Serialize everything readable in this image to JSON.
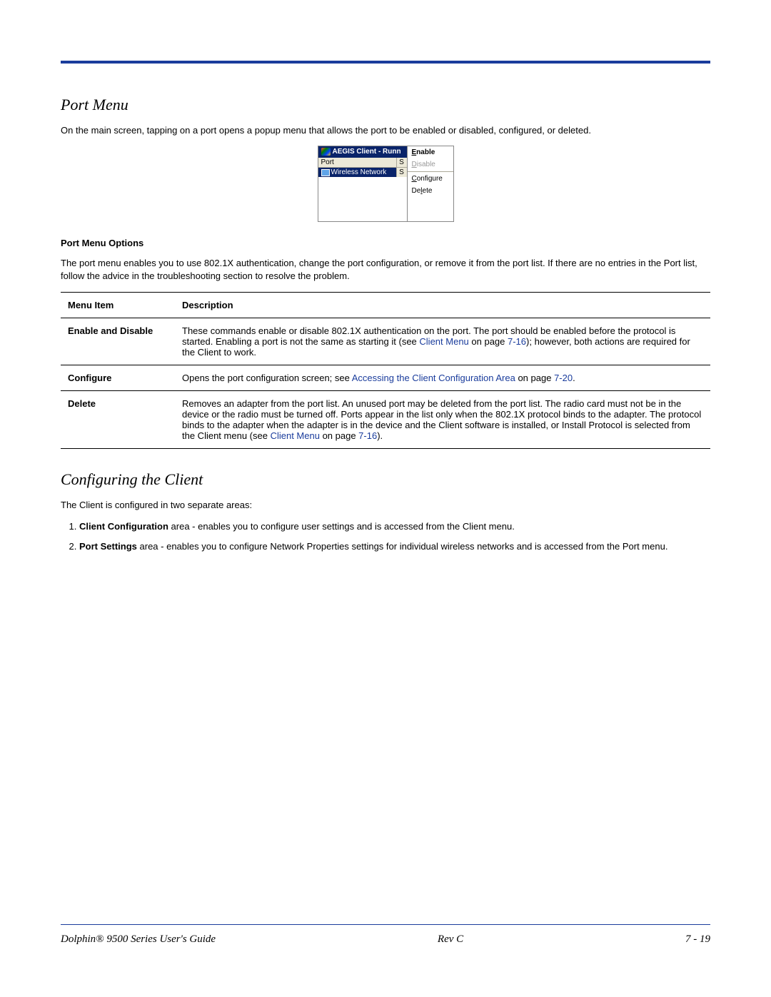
{
  "section1": {
    "heading": "Port Menu",
    "intro": "On the main screen, tapping on a port opens a popup menu that allows the port to be enabled or disabled, configured, or deleted."
  },
  "screenshot": {
    "title": "AEGIS Client - Runn",
    "col_port": "Port",
    "col_s": "S",
    "row_port": "Wireless Network",
    "row_s": "S",
    "menu": {
      "enable": "Enable",
      "disable": "Disable",
      "configure": "Configure",
      "delete": "Delete"
    }
  },
  "options": {
    "heading": "Port Menu Options",
    "intro": "The port menu enables you to use 802.1X authentication, change the port configuration, or remove it from the port list. If there are no entries in the Port list, follow the advice in the troubleshooting section to resolve the problem.",
    "th1": "Menu Item",
    "th2": "Description",
    "rows": [
      {
        "item": "Enable and Disable",
        "desc_a": "These commands enable or disable 802.1X authentication on the port. The port should be enabled before the protocol is started. Enabling a port is not the same as starting it (see ",
        "link1": "Client Menu",
        "desc_b": " on page ",
        "link2": "7-16",
        "desc_c": "); however, both actions are required for the Client to work."
      },
      {
        "item": "Configure",
        "desc_a": "Opens the port configuration screen; see ",
        "link1": "Accessing the Client Configuration Area",
        "desc_b": " on page ",
        "link2": "7-20",
        "desc_c": "."
      },
      {
        "item": "Delete",
        "desc_a": "Removes an adapter from the port list. An unused port may be deleted from the port list. The radio card must not be in the device or the radio must be turned off. Ports appear in the list only when the 802.1X protocol binds to the adapter. The protocol binds to the adapter when the adapter is in the device and the Client software is installed, or Install Protocol is selected from the Client menu (see ",
        "link1": "Client Menu",
        "desc_b": " on page ",
        "link2": "7-16",
        "desc_c": ")."
      }
    ]
  },
  "section2": {
    "heading": "Configuring the Client",
    "intro": "The Client is configured in two separate areas:",
    "list": [
      {
        "bold": "Client Configuration",
        "rest": " area - enables you to configure user settings and is accessed from the Client menu."
      },
      {
        "bold": "Port Settings",
        "rest": " area - enables you to configure Network Properties settings for individual wireless networks and is accessed from the Port menu."
      }
    ]
  },
  "footer": {
    "left": "Dolphin® 9500 Series User's Guide",
    "center": "Rev C",
    "right": "7 - 19"
  }
}
